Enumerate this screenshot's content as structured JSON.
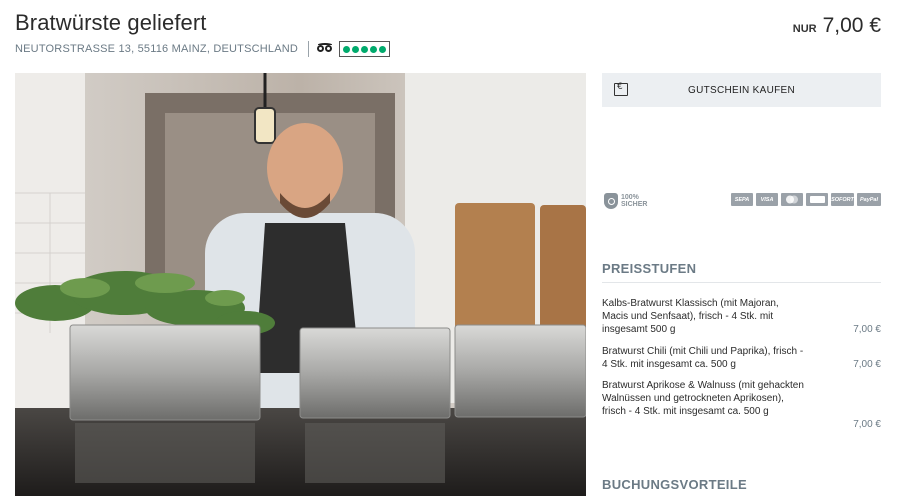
{
  "product": {
    "title": "Bratwürste geliefert",
    "address": "NEUTORSTRASSE 13, 55116 MAINZ, DEUTSCHLAND",
    "rating_icon": "tripadvisor-owl-icon",
    "rating_dots": 5,
    "price_prefix": "NUR",
    "price": "7,00 €"
  },
  "sidebar": {
    "voucher_button": "GUTSCHEIN KAUFEN",
    "voucher_icon": "euro-voucher-icon",
    "secure_badge": [
      "100%",
      "SICHER"
    ],
    "payment_methods": [
      "SEPA",
      "VISA",
      "Mastercard",
      "Google Pay",
      "SOFORT",
      "PayPal"
    ],
    "price_tiers_heading": "PREISSTUFEN",
    "tiers": [
      {
        "name": "Kalbs-Bratwurst Klassisch (mit Majoran, Macis und Senfsaat), frisch - 4 Stk. mit insgesamt 500 g",
        "price": "7,00 €"
      },
      {
        "name": "Bratwurst Chili (mit Chili und Paprika), frisch - 4 Stk. mit insgesamt ca. 500 g",
        "price": "7,00 €"
      },
      {
        "name": "Bratwurst Aprikose & Walnuss (mit gehackten Walnüssen und getrockneten Aprikosen), frisch - 4 Stk. mit insgesamt ca. 500 g",
        "price": "7,00 €"
      }
    ],
    "booking_heading": "BUCHUNGSVORTEILE"
  },
  "colors": {
    "heading_grey": "#6b7a85",
    "button_bg": "#eceff2",
    "rating_green": "#00aa6c"
  }
}
